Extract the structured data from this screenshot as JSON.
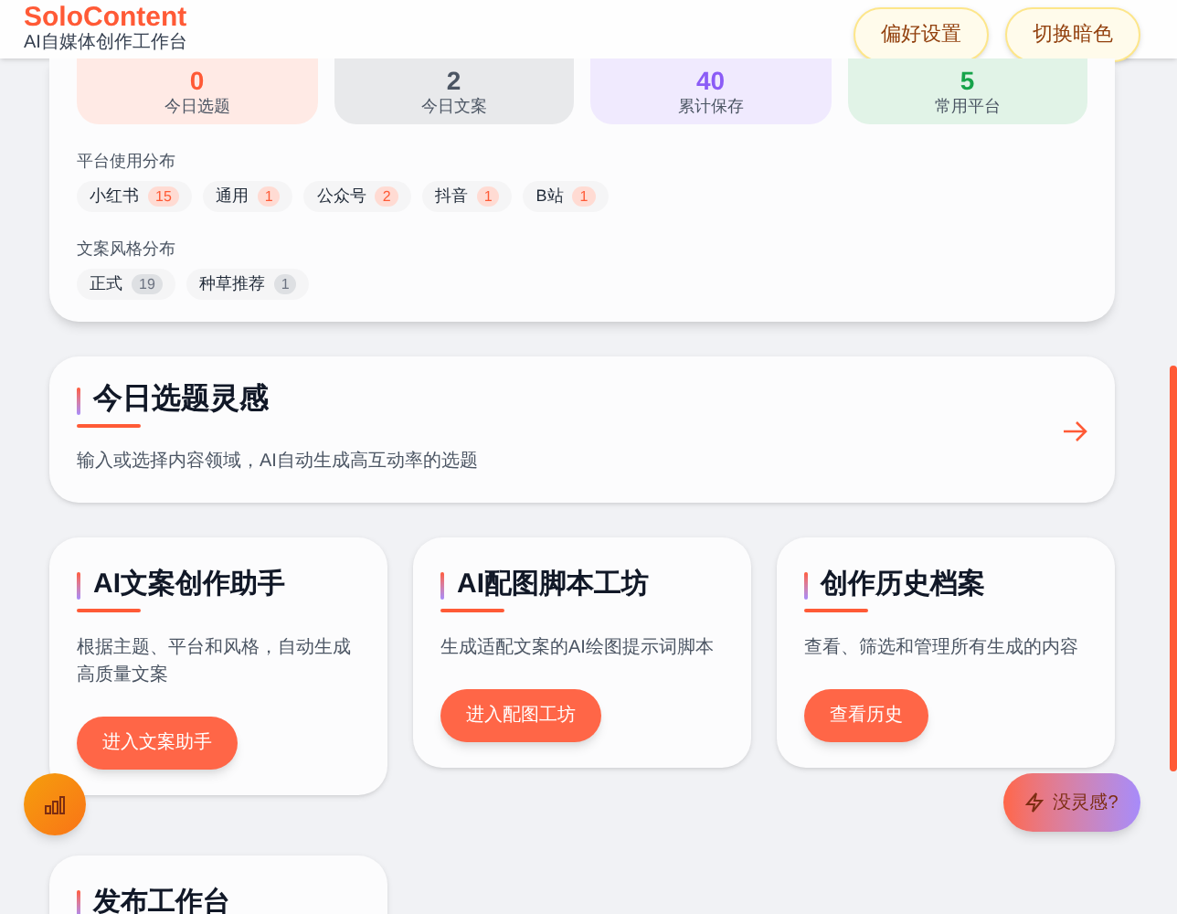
{
  "header": {
    "title": "SoloContent",
    "subtitle": "AI自媒体创作工作台",
    "buttons": [
      "偏好设置",
      "切换暗色"
    ]
  },
  "stats": [
    {
      "value": "0",
      "label": "今日选题",
      "color": "#ff5a36"
    },
    {
      "value": "2",
      "label": "今日文案",
      "color": "#4b5563"
    },
    {
      "value": "40",
      "label": "累计保存",
      "color": "#8b5cf6"
    },
    {
      "value": "5",
      "label": "常用平台",
      "color": "#16a34a"
    }
  ],
  "distributions": [
    {
      "title": "平台使用分布",
      "color": "#ff5a36",
      "items": [
        {
          "label": "小红书",
          "count": "15"
        },
        {
          "label": "通用",
          "count": "1"
        },
        {
          "label": "公众号",
          "count": "2"
        },
        {
          "label": "抖音",
          "count": "1"
        },
        {
          "label": "B站",
          "count": "1"
        }
      ]
    },
    {
      "title": "文案风格分布",
      "color": "#6b7280",
      "items": [
        {
          "label": "正式",
          "count": "19"
        },
        {
          "label": "种草推荐",
          "count": "1"
        }
      ]
    }
  ],
  "inspiration": {
    "title": "今日选题灵感",
    "description": "输入或选择内容领域，AI自动生成高互动率的选题"
  },
  "tools": [
    {
      "title": "AI文案创作助手",
      "description": "根据主题、平台和风格，自动生成高质量文案",
      "button": "进入文案助手"
    },
    {
      "title": "AI配图脚本工坊",
      "description": "生成适配文案的AI绘图提示词脚本",
      "button": "进入配图工坊"
    },
    {
      "title": "创作历史档案",
      "description": "查看、筛选和管理所有生成的内容",
      "button": "查看历史"
    },
    {
      "title": "发布工作台"
    }
  ],
  "floating": {
    "inspiration_button": "没灵感?"
  }
}
